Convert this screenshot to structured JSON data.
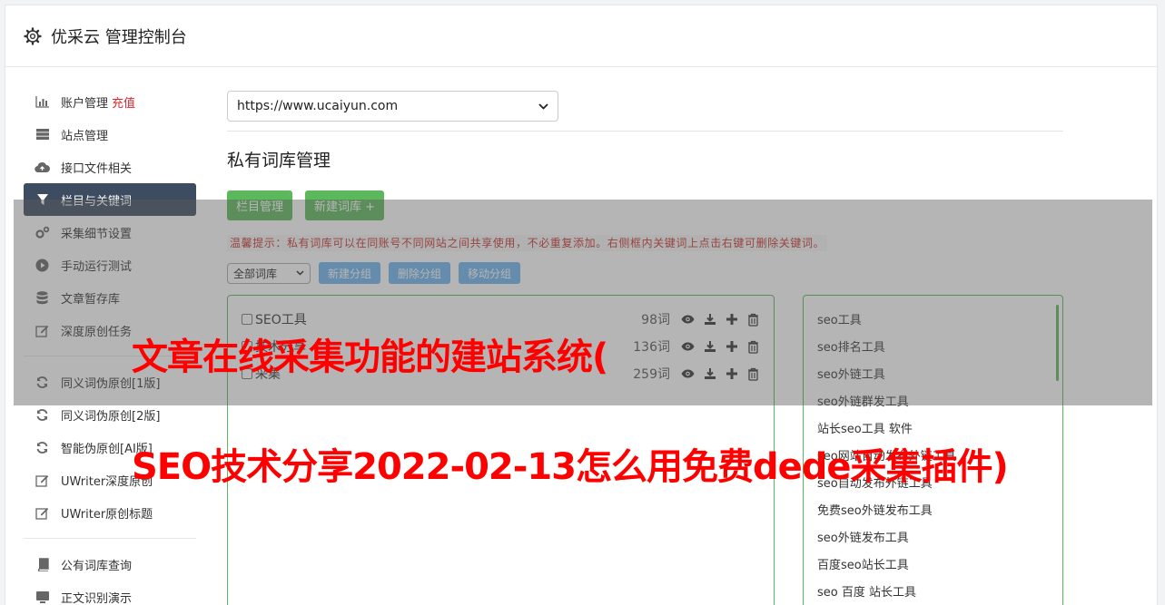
{
  "header": {
    "title": "优采云 管理控制台"
  },
  "sidebar": {
    "items": [
      {
        "label": "账户管理",
        "badge": "充值",
        "icon": "bar-chart-icon"
      },
      {
        "label": "站点管理",
        "icon": "server-icon"
      },
      {
        "label": "接口文件相关",
        "icon": "cloud-upload-icon"
      },
      {
        "label": "栏目与关键词",
        "icon": "filter-icon",
        "active": true
      },
      {
        "label": "采集细节设置",
        "icon": "gears-icon"
      },
      {
        "label": "手动运行测试",
        "icon": "play-circle-icon"
      },
      {
        "label": "文章暂存库",
        "icon": "database-icon"
      },
      {
        "label": "深度原创任务",
        "icon": "edit-icon"
      }
    ],
    "items2": [
      {
        "label": "同义词伪原创[1版]",
        "icon": "refresh-icon"
      },
      {
        "label": "同义词伪原创[2版]",
        "icon": "refresh-icon"
      },
      {
        "label": "智能伪原创[AI版]",
        "icon": "refresh-icon"
      },
      {
        "label": "UWriter深度原创",
        "icon": "edit-icon"
      },
      {
        "label": "UWriter原创标题",
        "icon": "edit-icon"
      }
    ],
    "items3": [
      {
        "label": "公有词库查询",
        "icon": "book-icon"
      },
      {
        "label": "正文识别演示",
        "icon": "monitor-icon"
      }
    ]
  },
  "main": {
    "site_select": "https://www.ucaiyun.com",
    "section_title": "私有词库管理",
    "btn_column_manage": "栏目管理",
    "btn_new_lexicon": "新建词库 +",
    "tip": "温馨提示：私有词库可以在同账号不同网站之间共享使用，不必重复添加。右侧框内关键词上点击右键可删除关键词。",
    "filter_select": "全部词库",
    "btn_new_group": "新建分组",
    "btn_delete_group": "删除分组",
    "btn_move_group": "移动分组",
    "groups": [
      {
        "name": "SEO工具",
        "count": "98词"
      },
      {
        "name": "技术分享",
        "count": "136词"
      },
      {
        "name": "采集",
        "count": "259词"
      }
    ],
    "keywords": [
      "seo工具",
      "seo排名工具",
      "seo外链工具",
      "seo外链群发工具",
      "站长seo工具 软件",
      "seo网站自动发布外链工具",
      "seo自动发布外链工具",
      "免费seo外链发布工具",
      "seo外链发布工具",
      "百度seo站长工具",
      "seo 百度 站长工具"
    ]
  },
  "overlay": {
    "line1": "文章在线采集功能的建站系统(",
    "line2": "SEO技术分享2022-02-13怎么用免费dede采集插件)"
  },
  "colors": {
    "accent_green": "#5cb85c",
    "accent_blue": "#6eb5ee",
    "active_nav": "#3d4c60",
    "warning_red": "#c9302c"
  }
}
